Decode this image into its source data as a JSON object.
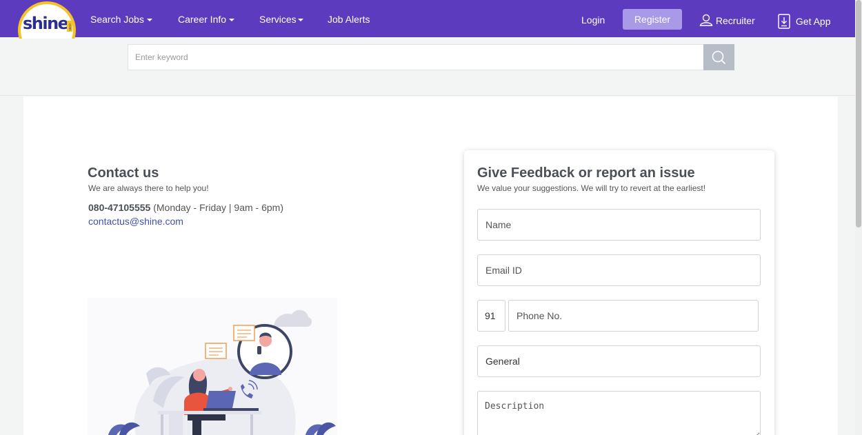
{
  "header": {
    "logo_text": "shine",
    "logo_suffix": ".com",
    "nav": {
      "search_jobs": "Search Jobs",
      "career_info": "Career Info",
      "services": "Services",
      "job_alerts": "Job Alerts"
    },
    "login": "Login",
    "register": "Register",
    "recruiter": "Recruiter",
    "get_app": "Get App"
  },
  "search": {
    "placeholder": "Enter keyword"
  },
  "contact": {
    "title": "Contact us",
    "subtitle": "We are always there to help you!",
    "phone": "080-47105555",
    "hours": "(Monday - Friday | 9am - 6pm)",
    "email": "contactus@shine.com"
  },
  "feedback": {
    "title": "Give Feedback or report an issue",
    "subtitle": "We value your suggestions. We will try to revert at the earliest!",
    "name_placeholder": "Name",
    "email_placeholder": "Email ID",
    "country_code": "91",
    "phone_placeholder": "Phone No.",
    "category": "General",
    "description_placeholder": "Description"
  },
  "colors": {
    "header_bg": "#5d3bbf",
    "register_bg": "#a99ae8",
    "link": "#3f51a6",
    "logo_yellow": "#f6c327"
  }
}
